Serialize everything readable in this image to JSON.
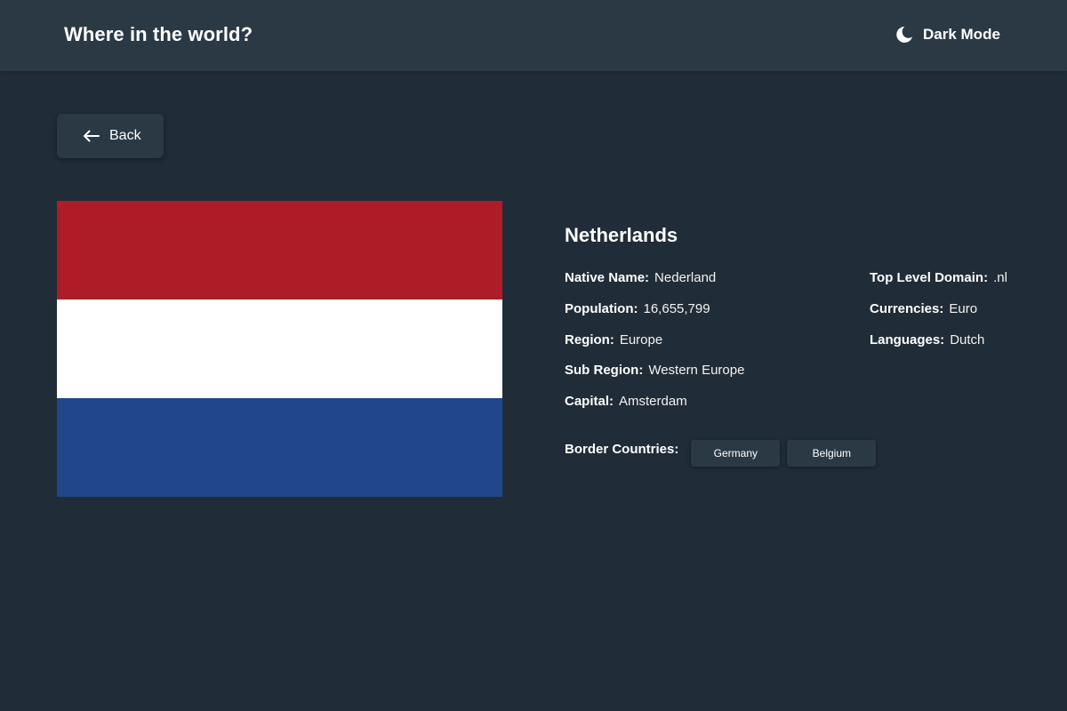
{
  "header": {
    "title": "Where in the world?",
    "mode_label": "Dark Mode",
    "mode_icon": "moon-icon"
  },
  "back": {
    "label": "Back",
    "icon": "arrow-left-icon"
  },
  "country": {
    "name": "Netherlands",
    "flag_colors": [
      "#ae1c28",
      "#ffffff",
      "#21468b"
    ],
    "left_fields": [
      {
        "key": "Native Name:",
        "value": "Nederland"
      },
      {
        "key": "Population:",
        "value": "16,655,799"
      },
      {
        "key": "Region:",
        "value": "Europe"
      },
      {
        "key": "Sub Region:",
        "value": "Western Europe"
      },
      {
        "key": "Capital:",
        "value": "Amsterdam"
      }
    ],
    "right_fields": [
      {
        "key": "Top Level Domain:",
        "value": ".nl"
      },
      {
        "key": "Currencies:",
        "value": "Euro"
      },
      {
        "key": "Languages:",
        "value": "Dutch"
      }
    ],
    "border_label": "Border Countries:",
    "borders": [
      "Germany",
      "Belgium"
    ]
  },
  "colors": {
    "background": "#202c37",
    "element": "#2b3945",
    "text": "#ffffff"
  }
}
